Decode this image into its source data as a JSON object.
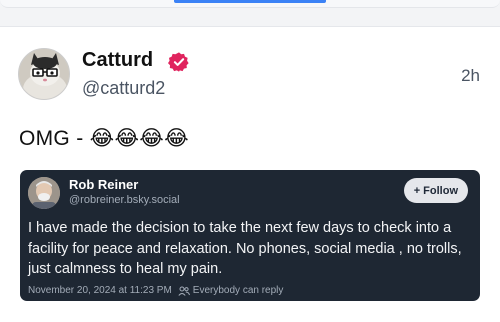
{
  "post": {
    "display_name": "Catturd",
    "handle": "@catturd2",
    "timestamp": "2h",
    "text": "OMG - 😂😂😂😂",
    "verified_icon": "verified-badge-icon"
  },
  "quoted": {
    "display_name": "Rob Reiner",
    "handle": "@robreiner.bsky.social",
    "follow_label": "+ Follow",
    "body": "I have made the decision to take the next few days to check into a facility for peace and relaxation. No phones, social media , no trolls, just calmness to heal my pain.",
    "date": "November 20, 2024 at 11:23 PM",
    "reply_setting": "Everybody can reply"
  },
  "colors": {
    "card_bg": "#1e2733",
    "verified": "#e0245e",
    "accent": "#3b82f6"
  }
}
